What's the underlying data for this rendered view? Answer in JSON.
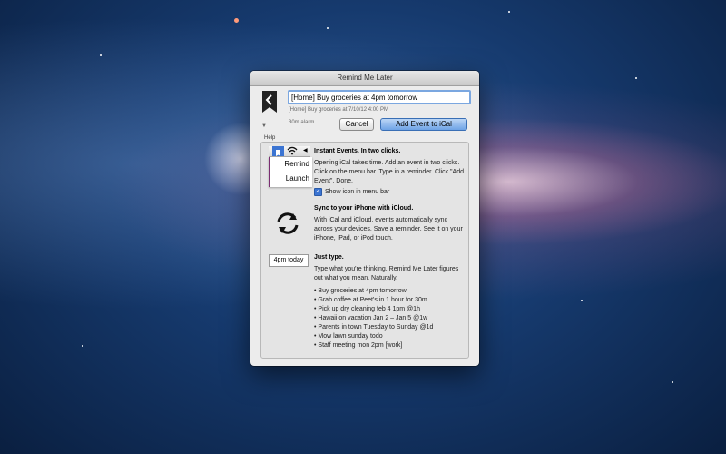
{
  "window": {
    "title": "Remind Me Later"
  },
  "composer": {
    "input_value": "[Home] Buy groceries at 4pm tomorrow",
    "preview": "[Home] Buy groceries at 7/10/12 4:00 PM",
    "alarm": "30m alarm",
    "cancel_label": "Cancel",
    "add_label": "Add Event to iCal",
    "disclosure": "▼",
    "help_label": "Help"
  },
  "help": {
    "menu_mock": {
      "items": [
        "Remind",
        "Launch"
      ]
    },
    "instant": {
      "title": "Instant Events. In two clicks.",
      "body": "Opening iCal takes time. Add an event in two clicks. Click on the menu bar. Type in a reminder. Click \"Add Event\". Done.",
      "checkbox_label": "Show icon in menu bar"
    },
    "sync": {
      "title": "Sync to your iPhone with iCloud.",
      "body": "With iCal and iCloud, events automatically sync across your devices. Save a reminder. See it on your iPhone, iPad, or iPod touch."
    },
    "type": {
      "today_example": "4pm today",
      "title": "Just type.",
      "body": "Type what you're thinking. Remind Me Later figures out what you mean. Naturally.",
      "examples": [
        "Buy groceries at 4pm tomorrow",
        "Grab coffee at Peet's in 1 hour for 30m",
        "Pick up dry cleaning feb 4 1pm @1h",
        "Hawaii on vacation Jan 2 – Jan 5 @1w",
        "Parents in town Tuesday to Sunday @1d",
        "Mow lawn sunday todo",
        "Staff meeting mon 2pm [work]"
      ]
    }
  },
  "colors": {
    "accent": "#3b74d2",
    "menu_border": "#7a2e72"
  }
}
